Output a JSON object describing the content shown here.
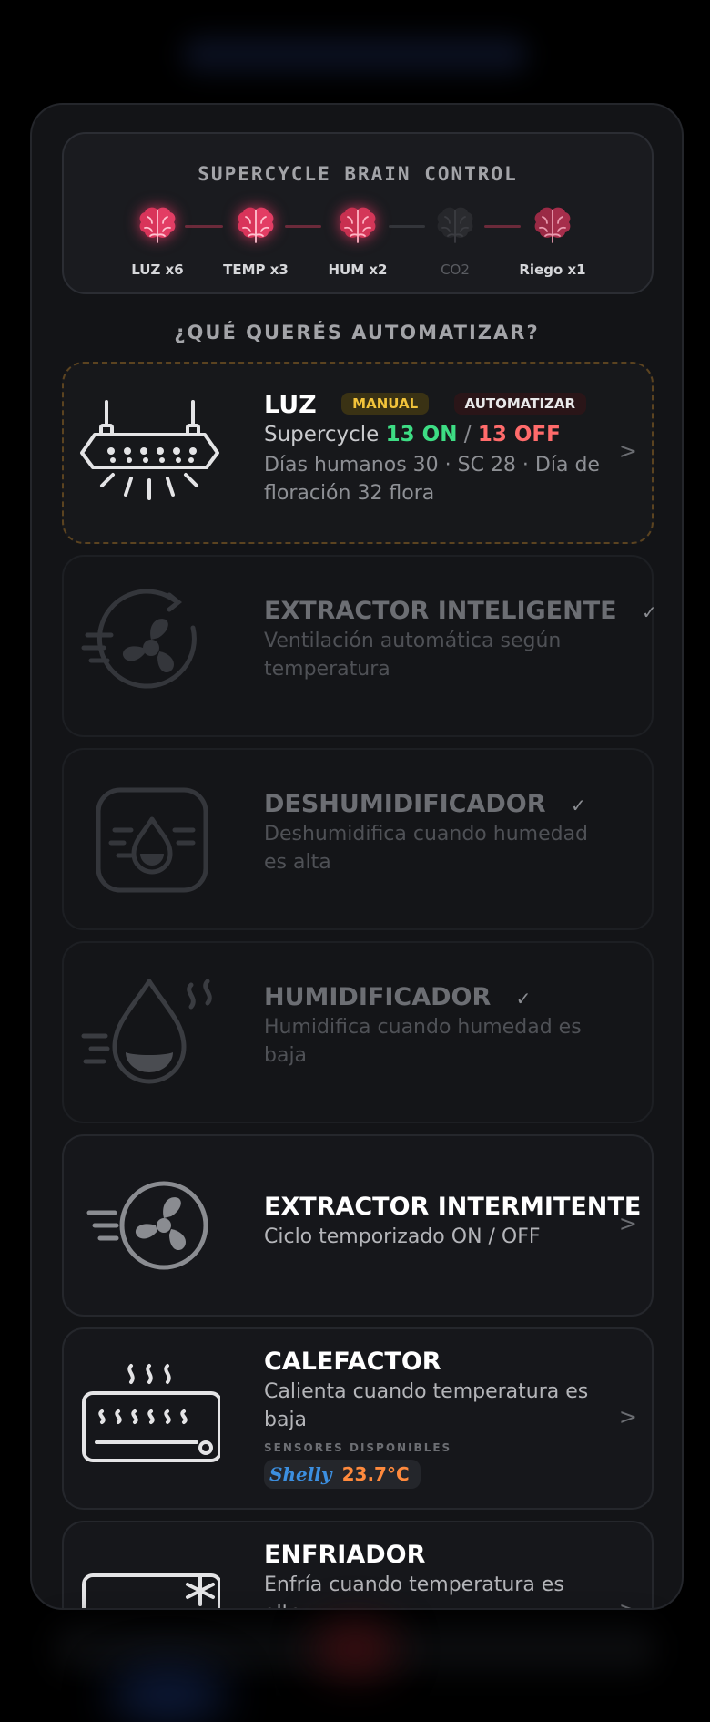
{
  "brain_control": {
    "title": "SUPERCYCLE BRAIN CONTROL",
    "nodes": [
      {
        "label": "LUZ x6",
        "active": true
      },
      {
        "label": "TEMP x3",
        "active": true
      },
      {
        "label": "HUM x2",
        "active": true
      },
      {
        "label": "CO2",
        "active": false
      },
      {
        "label": "Riego x1",
        "active": true
      }
    ],
    "colors": {
      "active": "#ff3c6e",
      "inactive": "#3a3b40",
      "connector_on": "#6b2a3a",
      "connector_off": "#33353a"
    }
  },
  "section_title": "¿QUÉ QUERÉS AUTOMATIZAR?",
  "cards": {
    "luz": {
      "title": "LUZ",
      "badge_manual": "MANUAL",
      "badge_auto": "AUTOMATIZAR",
      "supercycle_prefix": "Supercycle",
      "on_value": "13 ON",
      "separator": "/",
      "off_value": "13 OFF",
      "details": "Días humanos 30 · SC 28 · Día de floración 32 flora",
      "chevron": ">"
    },
    "extractor_inteligente": {
      "title": "EXTRACTOR INTELIGENTE",
      "check": "✓",
      "desc": "Ventilación automática según temperatura"
    },
    "deshumidificador": {
      "title": "DESHUMIDIFICADOR",
      "check": "✓",
      "desc": "Deshumidifica cuando humedad es alta"
    },
    "humidificador": {
      "title": "HUMIDIFICADOR",
      "check": "✓",
      "desc": "Humidifica cuando humedad es baja"
    },
    "extractor_intermitente": {
      "title": "EXTRACTOR INTERMITENTE",
      "desc": "Ciclo temporizado ON / OFF",
      "chevron": ">"
    },
    "calefactor": {
      "title": "CALEFACTOR",
      "desc": "Calienta cuando temperatura es baja",
      "sensors_label": "SENSORES DISPONIBLES",
      "sensor_brand": "Shelly",
      "sensor_temp": "23.7°C",
      "chevron": ">"
    },
    "enfriador": {
      "title": "ENFRIADOR",
      "desc": "Enfría cuando temperatura es alta",
      "chevron": ">"
    }
  },
  "icons": {
    "brain": "brain-icon",
    "lamp": "grow-light-icon",
    "smart_fan": "smart-extractor-icon",
    "dehumidifier": "dehumidifier-icon",
    "humidifier": "humidifier-icon",
    "fan": "extractor-fan-icon",
    "heater": "heater-icon",
    "cooler": "cooler-icon"
  }
}
